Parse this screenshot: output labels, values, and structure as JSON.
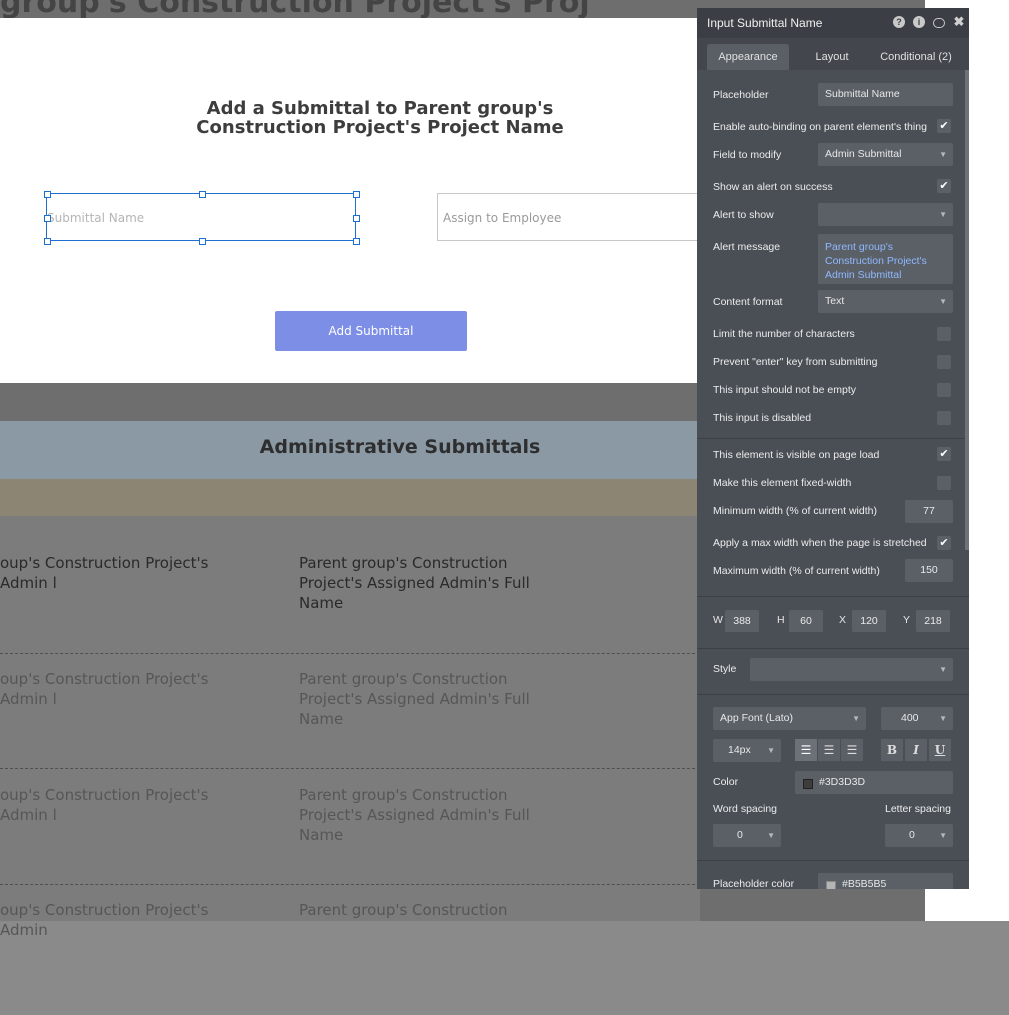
{
  "page": {
    "top_title": "group's Construction Project's Proj",
    "form_title": "Add a Submittal to Parent group's Construction Project's Project Name",
    "submittal_placeholder": "Submittal Name",
    "employee_placeholder": "Assign to Employee",
    "add_button": "Add Submittal",
    "admin_section_title": "Administrative Submittals",
    "rows": [
      {
        "c1": "oup's Construction Project's Admin l",
        "c2": "Parent group's Construction Project's Assigned Admin's Full Name",
        "color": "#2a2a2a"
      },
      {
        "c1": "oup's Construction Project's Admin l",
        "c2": "Parent group's Construction Project's Assigned Admin's Full Name",
        "color": "#5a5a5a"
      },
      {
        "c1": "oup's Construction Project's Admin l",
        "c2": "Parent group's Construction Project's Assigned Admin's Full Name",
        "color": "#5a5a5a"
      },
      {
        "c1": "oup's Construction Project's Admin",
        "c2": "Parent group's Construction",
        "color": "#5a5a5a"
      }
    ]
  },
  "editor": {
    "title": "Input Submittal Name",
    "header_icons": [
      "help-icon",
      "info-icon",
      "comment-icon",
      "close-icon"
    ],
    "tabs": [
      "Appearance",
      "Layout",
      "Conditional (2)"
    ],
    "placeholder_label": "Placeholder",
    "placeholder_value": "Submittal Name",
    "autobind_label": "Enable auto-binding on parent element's thing",
    "field_modify_label": "Field to modify",
    "field_modify_value": "Admin Submittal",
    "alert_success_label": "Show an alert on success",
    "alert_show_label": "Alert to show",
    "alert_show_value": "",
    "alert_message_label": "Alert message",
    "alert_message_value": " Parent group's Construction Project's Admin Submittal",
    "content_format_label": "Content format",
    "content_format_value": "Text",
    "limit_chars_label": "Limit the number of characters",
    "prevent_enter_label": "Prevent \"enter\" key from submitting",
    "not_empty_label": "This input should not be empty",
    "disabled_label": "This input is disabled",
    "visible_label": "This element is visible on page load",
    "fixed_width_label": "Make this element fixed-width",
    "min_width_label": "Minimum width (% of current width)",
    "min_width_value": "77",
    "max_width_apply_label": "Apply a max width when the page is stretched",
    "max_width_label": "Maximum width (% of current width)",
    "max_width_value": "150",
    "w_label": "W",
    "w_value": "388",
    "h_label": "H",
    "h_value": "60",
    "x_label": "X",
    "x_value": "120",
    "y_label": "Y",
    "y_value": "218",
    "style_label": "Style",
    "style_value": "",
    "font_value": "App Font (Lato)",
    "weight_value": "400",
    "size_value": "14px",
    "bold_glyph": "B",
    "italic_glyph": "I",
    "underline_glyph": "U",
    "color_label": "Color",
    "color_value": "#3D3D3D",
    "word_spacing_label": "Word spacing",
    "word_spacing_value": "0",
    "letter_spacing_label": "Letter spacing",
    "letter_spacing_value": "0",
    "placeholder_color_label": "Placeholder color",
    "placeholder_color_value": "#B5B5B5",
    "check_glyph": "✔",
    "dropdown_glyph": "▼"
  }
}
